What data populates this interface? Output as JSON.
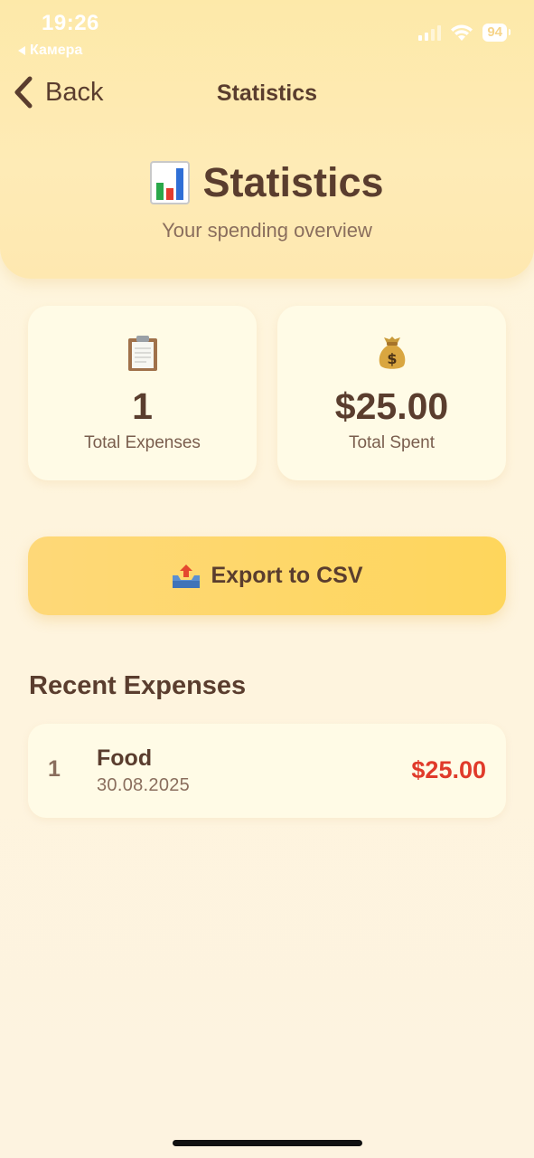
{
  "status_bar": {
    "time": "19:26",
    "back_app": "Камера",
    "battery": "94"
  },
  "nav": {
    "back_label": "Back",
    "title": "Statistics"
  },
  "hero": {
    "icon": "bar-chart-icon",
    "title": "Statistics",
    "subtitle": "Your spending overview"
  },
  "summary": [
    {
      "icon": "clipboard-icon",
      "value": "1",
      "label": "Total Expenses"
    },
    {
      "icon": "money-bag-icon",
      "value": "$25.00",
      "label": "Total Spent"
    }
  ],
  "export": {
    "icon": "outbox-tray-icon",
    "label": "Export to CSV"
  },
  "recent": {
    "title": "Recent Expenses",
    "items": [
      {
        "index": "1",
        "category": "Food",
        "date": "30.08.2025",
        "amount": "$25.00"
      }
    ]
  },
  "colors": {
    "accent": "#fed65c",
    "header_bg": "#fde9a9",
    "text": "#5a3d2e",
    "amount": "#e03a2a"
  }
}
